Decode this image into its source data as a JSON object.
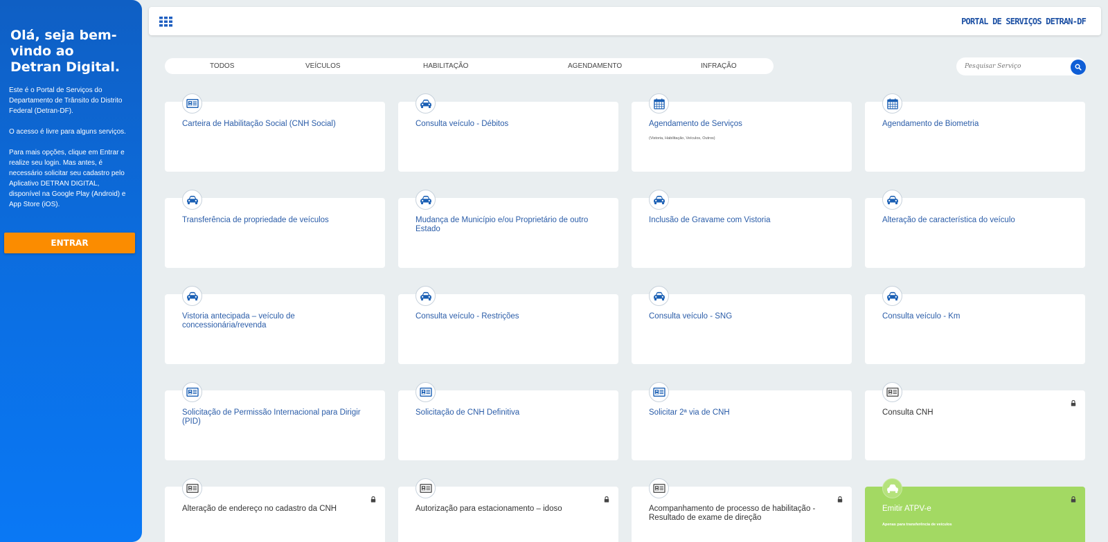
{
  "sidebar": {
    "greeting": "Olá, seja bem-vindo ao Detran Digital.",
    "paragraphs": [
      "Este é o Portal de Serviços do Departamento de Trânsito do Distrito Federal (Detran-DF).",
      "O acesso é livre para alguns serviços.",
      "Para mais opções, clique em Entrar e realize seu login. Mas antes, é necessário solicitar seu cadastro pelo Aplicativo DETRAN DIGITAL, disponível na Google Play (Android) e App Store (iOS)."
    ],
    "enter_label": "ENTRAR"
  },
  "header": {
    "title": "PORTAL DE SERVIÇOS DETRAN-DF"
  },
  "tabs": [
    "TODOS",
    "VEÍCULOS",
    "HABILITAÇÃO",
    "AGENDAMENTO",
    "INFRAÇÃO"
  ],
  "search": {
    "placeholder": "Pesquisar Serviço"
  },
  "colors": {
    "blue": "#1b4fa3",
    "accent": "#0f5ed6",
    "orange": "#fb8c00",
    "green": "#a3d963"
  },
  "cards": [
    {
      "title": "Carteira de Habilitação Social (CNH Social)",
      "icon": "id-card-icon",
      "locked": false
    },
    {
      "title": "Consulta veículo - Débitos",
      "icon": "car-icon",
      "locked": false
    },
    {
      "title": "Agendamento de Serviços",
      "subtitle": "(Vistoria, Habilitação, Veículos, Outros)",
      "icon": "calendar-icon",
      "locked": false
    },
    {
      "title": "Agendamento de Biometria",
      "icon": "calendar-icon",
      "locked": false
    },
    {
      "title": "Transferência de propriedade de veículos",
      "icon": "car-icon",
      "locked": false
    },
    {
      "title": "Mudança de Município e/ou Proprietário de outro Estado",
      "icon": "car-icon",
      "locked": false
    },
    {
      "title": "Inclusão de Gravame com Vistoria",
      "icon": "car-icon",
      "locked": false
    },
    {
      "title": "Alteração de característica do veículo",
      "icon": "car-icon",
      "locked": false
    },
    {
      "title": "Vistoria antecipada – veículo de concessionária/revenda",
      "icon": "car-icon",
      "locked": false
    },
    {
      "title": "Consulta veículo - Restrições",
      "icon": "car-icon",
      "locked": false
    },
    {
      "title": "Consulta veículo - SNG",
      "icon": "car-icon",
      "locked": false
    },
    {
      "title": "Consulta veículo - Km",
      "icon": "car-icon",
      "locked": false
    },
    {
      "title": "Solicitação de Permissão Internacional para Dirigir (PID)",
      "icon": "id-card-icon",
      "locked": false
    },
    {
      "title": "Solicitação de CNH Definitiva",
      "icon": "id-card-icon",
      "locked": false
    },
    {
      "title": "Solicitar 2ª via de CNH",
      "icon": "id-card-icon",
      "locked": false
    },
    {
      "title": "Consulta CNH",
      "icon": "id-card-icon",
      "locked": true
    },
    {
      "title": "Alteração de endereço no cadastro da CNH",
      "icon": "id-card-icon",
      "locked": true
    },
    {
      "title": "Autorização para estacionamento – idoso",
      "icon": "id-card-icon",
      "locked": true
    },
    {
      "title": "Acompanhamento de processo de habilitação - Resultado de exame de direção",
      "icon": "id-card-icon",
      "locked": true
    },
    {
      "title": "Emitir ATPV-e",
      "subtitle": "Apenas para transferência de veículos",
      "icon": "car-icon",
      "locked": true,
      "highlight": true
    }
  ]
}
